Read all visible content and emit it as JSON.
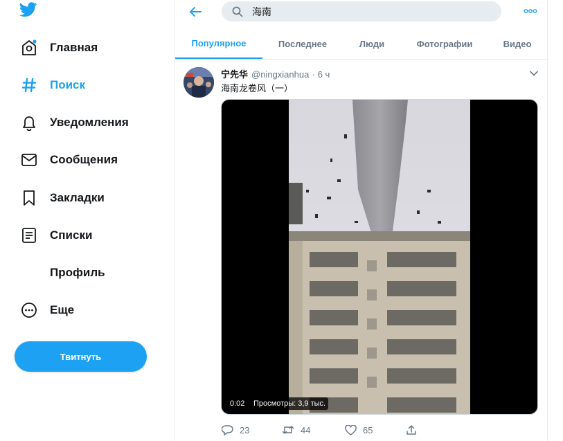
{
  "sidebar": {
    "logo_icon": "twitter-bird-icon",
    "items": [
      {
        "label": "Главная",
        "icon": "home-icon"
      },
      {
        "label": "Поиск",
        "icon": "hashtag-icon"
      },
      {
        "label": "Уведомления",
        "icon": "bell-icon"
      },
      {
        "label": "Сообщения",
        "icon": "envelope-icon"
      },
      {
        "label": "Закладки",
        "icon": "bookmark-icon"
      },
      {
        "label": "Списки",
        "icon": "list-icon"
      },
      {
        "label": "Профиль",
        "icon": "profile-icon"
      },
      {
        "label": "Еще",
        "icon": "more-circle-icon"
      }
    ],
    "tweet_button": "Твитнуть"
  },
  "header": {
    "search_value": "海南"
  },
  "tabs": [
    {
      "label": "Популярное"
    },
    {
      "label": "Последнее"
    },
    {
      "label": "Люди"
    },
    {
      "label": "Фотографии"
    },
    {
      "label": "Видео"
    }
  ],
  "tweet": {
    "name": "宁先华",
    "handle": "@ningxianhua",
    "dot": "·",
    "time": "6 ч",
    "text": "海南龙卷风（一）",
    "video": {
      "duration": "0:02",
      "views": "Просмотры: 3,9 тыс."
    },
    "actions": {
      "replies": "23",
      "retweets": "44",
      "likes": "65"
    }
  },
  "colors": {
    "accent": "#1da1f2",
    "text": "#14171a",
    "secondary": "#657786",
    "border": "#e6ecf0"
  }
}
